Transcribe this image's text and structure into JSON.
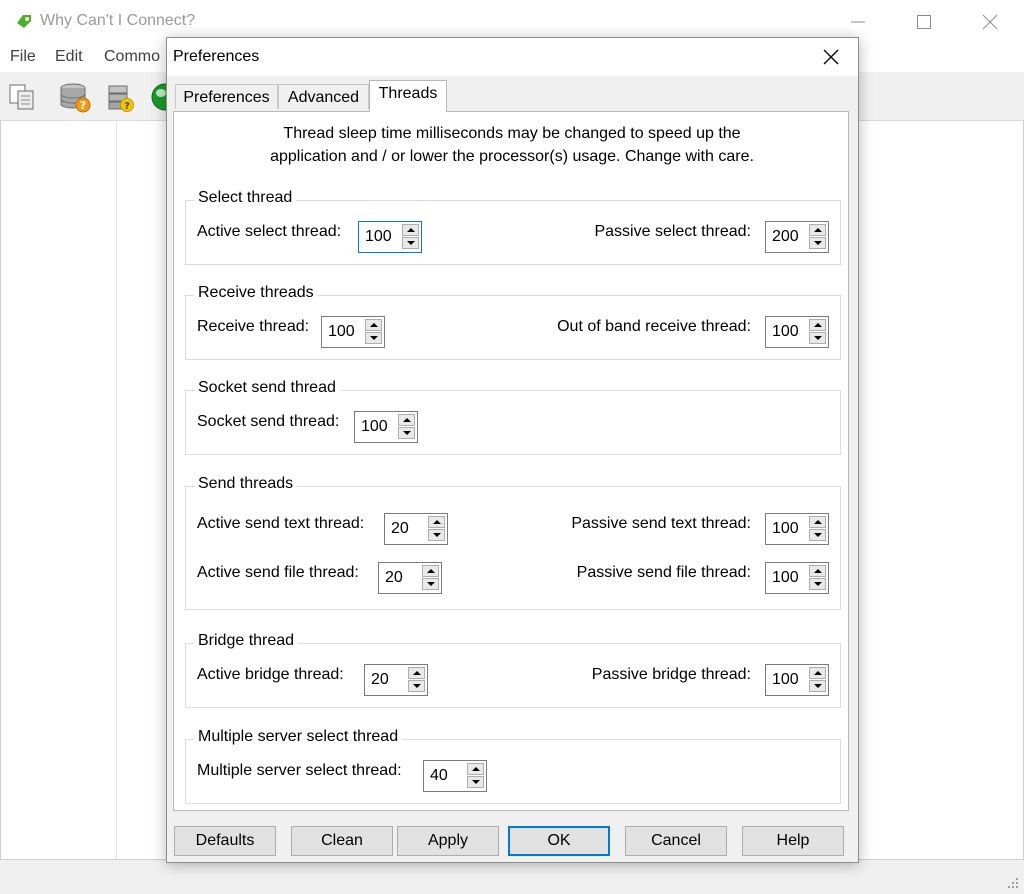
{
  "main_window": {
    "title": "Why Can't I Connect?",
    "menu": [
      "File",
      "Edit",
      "Commo"
    ],
    "toolbar_icons": [
      "copy-icon",
      "database-help-icon",
      "server-help-icon",
      "globe-icon"
    ]
  },
  "dialog": {
    "title": "Preferences",
    "tabs": [
      {
        "label": "Preferences",
        "active": false
      },
      {
        "label": "Advanced",
        "active": false
      },
      {
        "label": "Threads",
        "active": true
      }
    ],
    "description": [
      "Thread sleep time milliseconds may be changed to speed up the",
      "application and / or lower the processor(s) usage.  Change with care."
    ],
    "groups": [
      {
        "legend": "Select thread",
        "fields": [
          {
            "label": "Active select thread:",
            "value": "100",
            "focused": true
          },
          {
            "label": "Passive select thread:",
            "value": "200"
          }
        ]
      },
      {
        "legend": "Receive threads",
        "fields": [
          {
            "label": "Receive thread:",
            "value": "100"
          },
          {
            "label": "Out of band receive thread:",
            "value": "100"
          }
        ]
      },
      {
        "legend": "Socket send thread",
        "fields": [
          {
            "label": "Socket send thread:",
            "value": "100"
          }
        ]
      },
      {
        "legend": "Send threads",
        "fields": [
          {
            "label": "Active send text thread:",
            "value": "20"
          },
          {
            "label": "Passive send text thread:",
            "value": "100"
          },
          {
            "label": "Active send file thread:",
            "value": "20"
          },
          {
            "label": "Passive send file thread:",
            "value": "100"
          }
        ]
      },
      {
        "legend": "Bridge thread",
        "fields": [
          {
            "label": "Active bridge thread:",
            "value": "20"
          },
          {
            "label": "Passive bridge thread:",
            "value": "100"
          }
        ]
      },
      {
        "legend": "Multiple server select thread",
        "fields": [
          {
            "label": "Multiple server select thread:",
            "value": "40"
          }
        ]
      }
    ],
    "buttons": [
      "Defaults",
      "Clean",
      "Apply",
      "OK",
      "Cancel",
      "Help"
    ]
  }
}
